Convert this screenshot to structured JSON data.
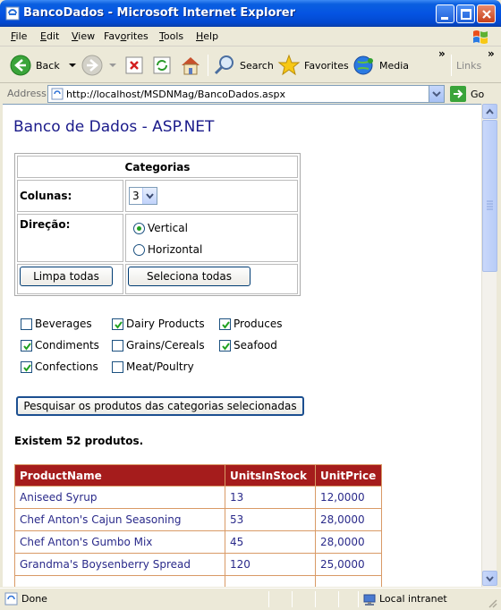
{
  "window": {
    "title": "BancoDados - Microsoft Internet Explorer"
  },
  "menu": {
    "items": [
      {
        "key": "F",
        "rest": "ile"
      },
      {
        "key": "E",
        "rest": "dit"
      },
      {
        "key": "V",
        "rest": "iew"
      },
      {
        "key": "Fav",
        "rest": "orites",
        "underline_index": 2
      },
      {
        "key": "T",
        "rest": "ools"
      },
      {
        "key": "H",
        "rest": "elp"
      }
    ]
  },
  "toolbar": {
    "back_label": "Back",
    "search_label": "Search",
    "favorites_label": "Favorites",
    "media_label": "Media",
    "links_label": "Links"
  },
  "address": {
    "label": "Address",
    "url": "http://localhost/MSDNMag/BancoDados.aspx",
    "go_label": "Go"
  },
  "page": {
    "title": "Banco de Dados - ASP.NET",
    "categories_header": "Categorias",
    "columns_label": "Colunas:",
    "columns_value": "3",
    "direction_label": "Direção:",
    "direction_options": [
      "Vertical",
      "Horizontal"
    ],
    "direction_selected": "Vertical",
    "clear_all_label": "Limpa todas",
    "select_all_label": "Seleciona todas",
    "categories": [
      {
        "name": "Beverages",
        "checked": false
      },
      {
        "name": "Dairy Products",
        "checked": true
      },
      {
        "name": "Produces",
        "checked": true
      },
      {
        "name": "Condiments",
        "checked": true
      },
      {
        "name": "Grains/Cereals",
        "checked": false
      },
      {
        "name": "Seafood",
        "checked": true
      },
      {
        "name": "Confections",
        "checked": true
      },
      {
        "name": "Meat/Poultry",
        "checked": false
      }
    ],
    "search_button_label": "Pesquisar os produtos das categorias selecionadas",
    "summary": "Existem 52 produtos.",
    "grid": {
      "columns": [
        "ProductName",
        "UnitsInStock",
        "UnitPrice"
      ],
      "rows": [
        [
          "Aniseed Syrup",
          "13",
          "12,0000"
        ],
        [
          "Chef Anton's Cajun Seasoning",
          "53",
          "28,0000"
        ],
        [
          "Chef Anton's Gumbo Mix",
          "45",
          "28,0000"
        ],
        [
          "Grandma's Boysenberry Spread",
          "120",
          "25,0000"
        ]
      ]
    }
  },
  "status": {
    "text": "Done",
    "zone": "Local intranet"
  },
  "colors": {
    "title_bar": "#0554e2",
    "grid_header": "#a51c1c",
    "link_text": "#2a2a8a",
    "page_title": "#1a1a8a"
  }
}
